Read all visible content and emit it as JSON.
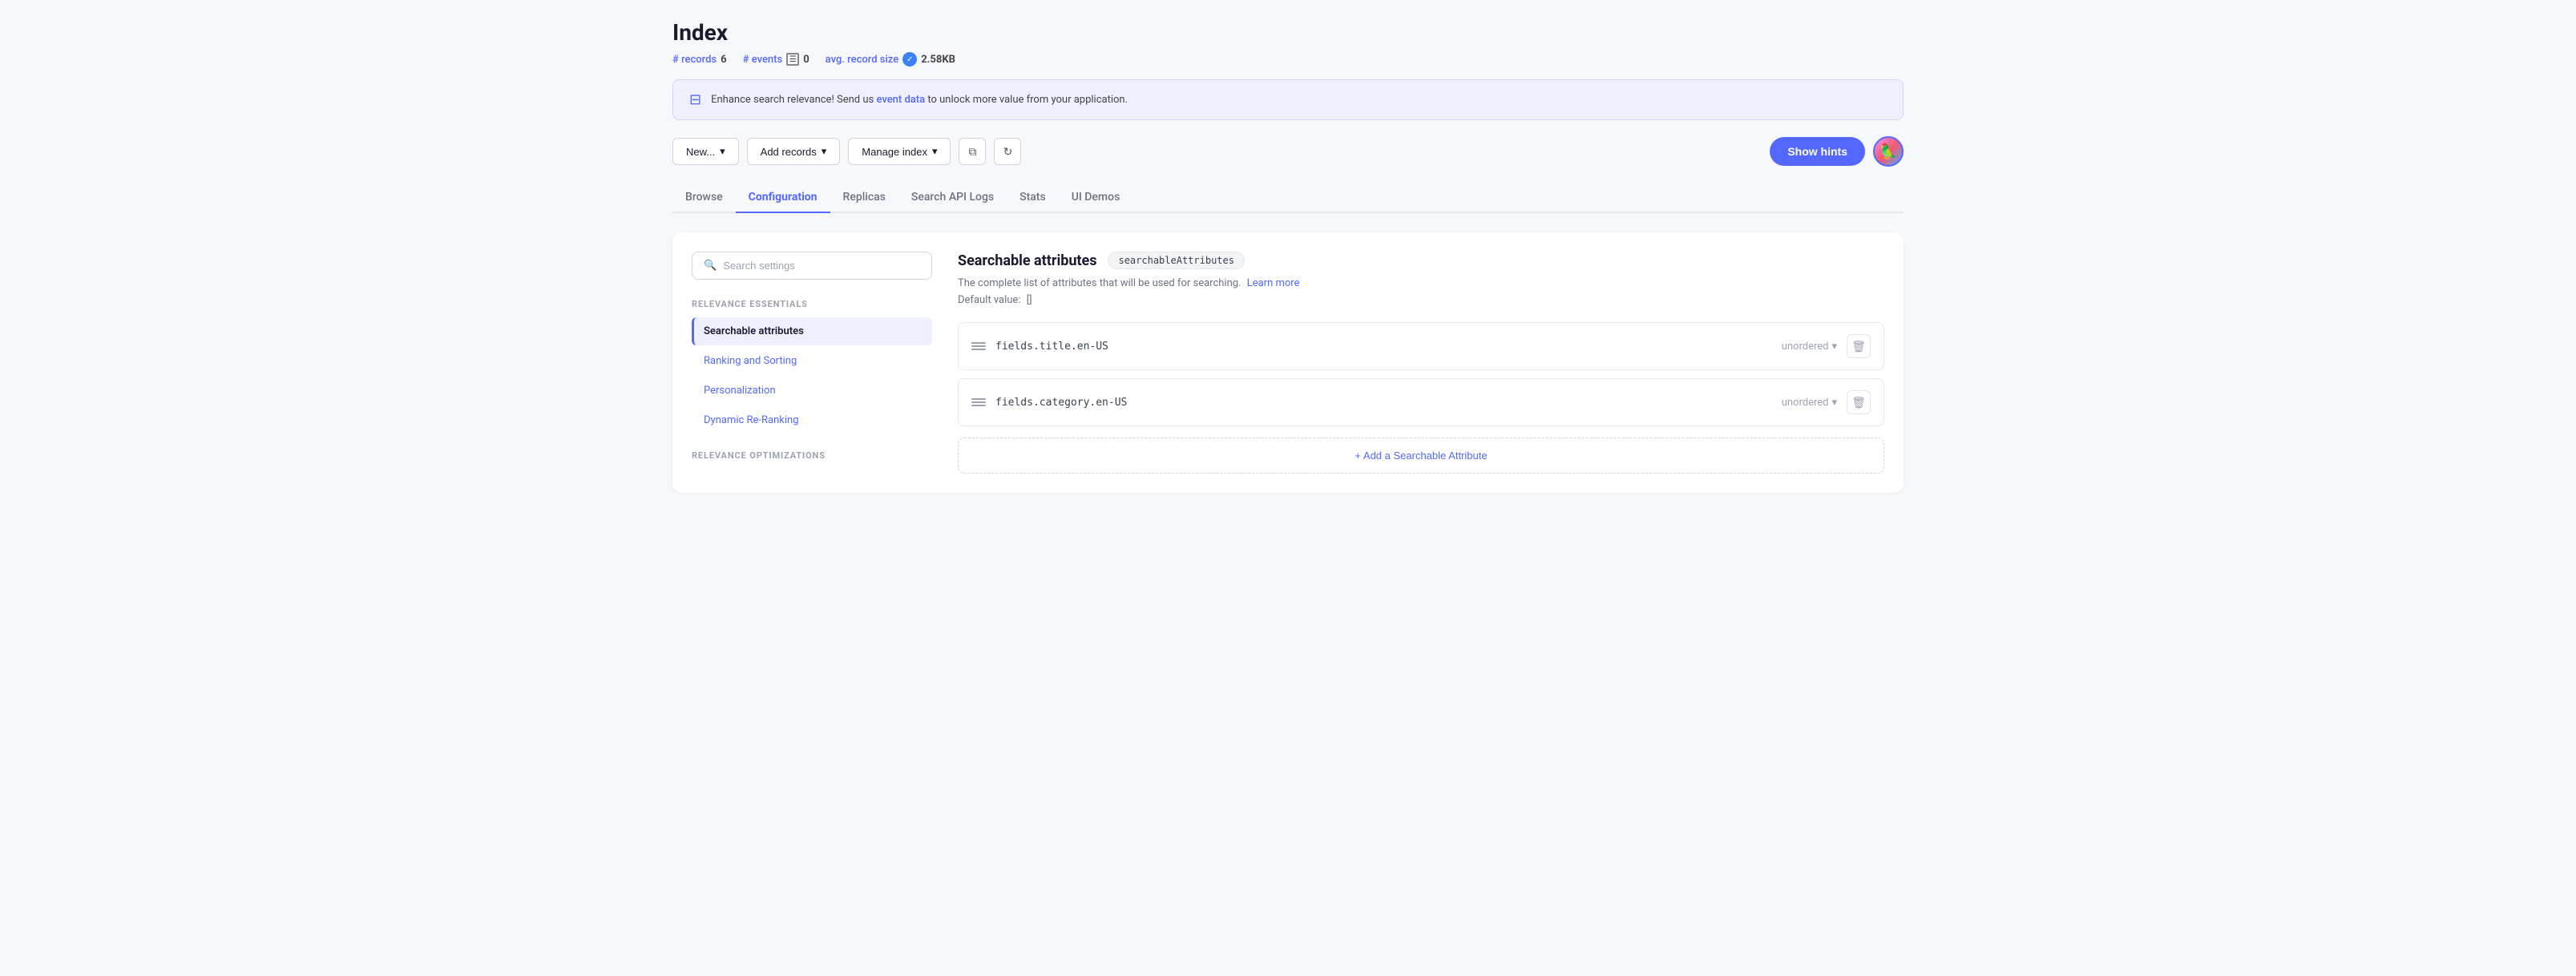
{
  "page": {
    "title": "Index",
    "stats": {
      "records_label": "# records",
      "records_value": "6",
      "events_label": "# events",
      "events_value": "0",
      "avg_size_label": "avg. record size",
      "avg_size_value": "2.58KB"
    },
    "banner": {
      "text": "Enhance search relevance! Send us ",
      "link_text": "event data",
      "text_after": " to unlock more value from your application."
    }
  },
  "toolbar": {
    "new_label": "New...",
    "add_records_label": "Add records",
    "manage_index_label": "Manage index",
    "show_hints_label": "Show hints"
  },
  "tabs": [
    {
      "id": "browse",
      "label": "Browse",
      "active": false
    },
    {
      "id": "configuration",
      "label": "Configuration",
      "active": true
    },
    {
      "id": "replicas",
      "label": "Replicas",
      "active": false
    },
    {
      "id": "search-api-logs",
      "label": "Search API Logs",
      "active": false
    },
    {
      "id": "stats",
      "label": "Stats",
      "active": false
    },
    {
      "id": "ui-demos",
      "label": "UI Demos",
      "active": false
    }
  ],
  "sidebar": {
    "search_placeholder": "Search settings",
    "sections": [
      {
        "title": "RELEVANCE ESSENTIALS",
        "items": [
          {
            "id": "searchable-attributes",
            "label": "Searchable attributes",
            "active": true
          },
          {
            "id": "ranking-sorting",
            "label": "Ranking and Sorting",
            "active": false
          },
          {
            "id": "personalization",
            "label": "Personalization",
            "active": false
          },
          {
            "id": "dynamic-re-ranking",
            "label": "Dynamic Re-Ranking",
            "active": false
          }
        ]
      },
      {
        "title": "RELEVANCE OPTIMIZATIONS",
        "items": []
      }
    ]
  },
  "main": {
    "setting_title": "Searchable attributes",
    "setting_badge": "searchableAttributes",
    "description": "The complete list of attributes that will be used for searching.",
    "learn_more_label": "Learn more",
    "default_value_label": "Default value:",
    "default_value": "[]",
    "attributes": [
      {
        "id": 1,
        "name": "fields.title.en-US",
        "order": "unordered"
      },
      {
        "id": 2,
        "name": "fields.category.en-US",
        "order": "unordered"
      }
    ],
    "add_button_label": "+ Add a Searchable Attribute"
  }
}
